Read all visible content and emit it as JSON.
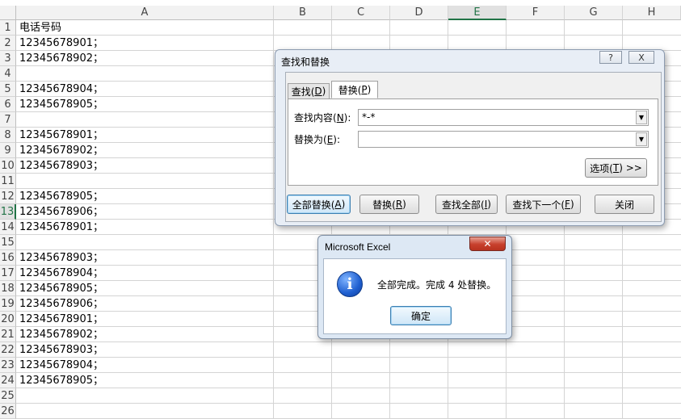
{
  "sheet": {
    "columns": [
      "A",
      "B",
      "C",
      "D",
      "E",
      "F",
      "G",
      "H"
    ],
    "selected_column": "E",
    "selected_row": "13",
    "rows": [
      {
        "num": "1",
        "a": "电话号码"
      },
      {
        "num": "2",
        "a": "12345678901；"
      },
      {
        "num": "3",
        "a": "12345678902；"
      },
      {
        "num": "4",
        "a": ""
      },
      {
        "num": "5",
        "a": "12345678904；"
      },
      {
        "num": "6",
        "a": "12345678905；"
      },
      {
        "num": "7",
        "a": ""
      },
      {
        "num": "8",
        "a": "12345678901；"
      },
      {
        "num": "9",
        "a": "12345678902；"
      },
      {
        "num": "10",
        "a": "12345678903；"
      },
      {
        "num": "11",
        "a": ""
      },
      {
        "num": "12",
        "a": "12345678905；"
      },
      {
        "num": "13",
        "a": "12345678906；"
      },
      {
        "num": "14",
        "a": "12345678901；"
      },
      {
        "num": "15",
        "a": ""
      },
      {
        "num": "16",
        "a": "12345678903；"
      },
      {
        "num": "17",
        "a": "12345678904；"
      },
      {
        "num": "18",
        "a": "12345678905；"
      },
      {
        "num": "19",
        "a": "12345678906；"
      },
      {
        "num": "20",
        "a": "12345678901；"
      },
      {
        "num": "21",
        "a": "12345678902；"
      },
      {
        "num": "22",
        "a": "12345678903；"
      },
      {
        "num": "23",
        "a": "12345678904；"
      },
      {
        "num": "24",
        "a": "12345678905；"
      },
      {
        "num": "25",
        "a": ""
      },
      {
        "num": "26",
        "a": ""
      }
    ]
  },
  "find_dialog": {
    "title": "查找和替换",
    "help_label": "?",
    "close_label": "X",
    "tabs": [
      {
        "label": "查找(",
        "key": "D",
        "suffix": ")"
      },
      {
        "label": "替换(",
        "key": "P",
        "suffix": ")"
      }
    ],
    "find_label": {
      "prefix": "查找内容(",
      "key": "N",
      "suffix": "):"
    },
    "find_value": "*-*",
    "replace_label": {
      "prefix": "替换为(",
      "key": "E",
      "suffix": "):"
    },
    "replace_value": "",
    "options_button": {
      "prefix": "选项(",
      "key": "T",
      "suffix": ") >>"
    },
    "buttons": [
      {
        "prefix": "全部替换(",
        "key": "A",
        "suffix": ")"
      },
      {
        "prefix": "替换(",
        "key": "R",
        "suffix": ")"
      },
      {
        "prefix": "查找全部(",
        "key": "I",
        "suffix": ")"
      },
      {
        "prefix": "查找下一个(",
        "key": "F",
        "suffix": ")"
      },
      {
        "prefix": "关闭",
        "key": "",
        "suffix": ""
      }
    ]
  },
  "message_box": {
    "title": "Microsoft Excel",
    "close_glyph": "✕",
    "icon_glyph": "i",
    "message": "全部完成。完成 4 处替换。",
    "ok_label": "确定"
  }
}
